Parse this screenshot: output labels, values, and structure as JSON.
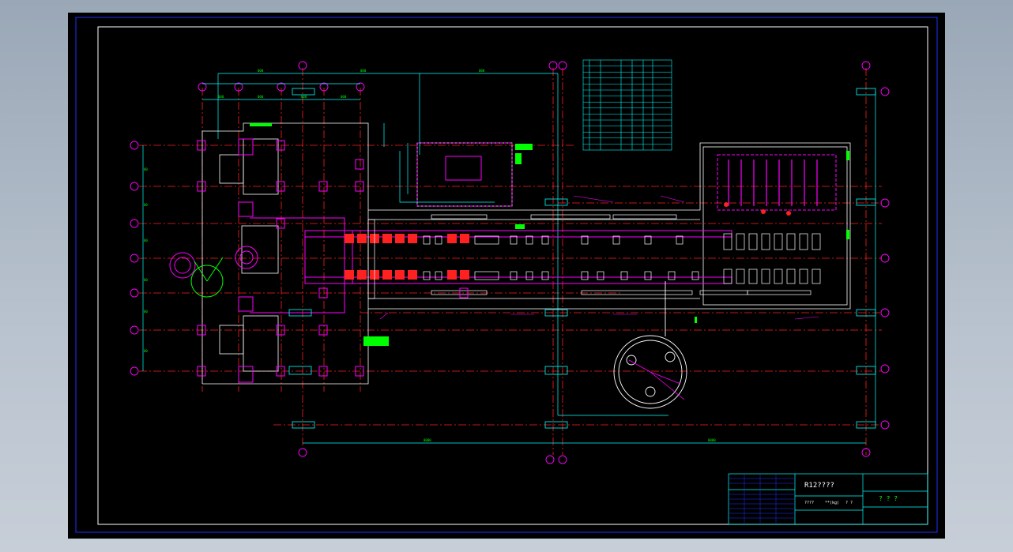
{
  "drawing": {
    "title_block_title": "R12????",
    "title_block_code": "? ? ?",
    "title_block_scale": "????",
    "title_block_ratio": "**(kg)",
    "title_block_marks": "? ?",
    "colors": {
      "background": "#000000",
      "frame": "#ffffff",
      "outer_frame": "#2030ff",
      "axis": "#ff2020",
      "dimension": "#00ffff",
      "equipment": "#ff00ff",
      "annotation": "#00ff00",
      "outline": "#ffffff"
    }
  },
  "table": {
    "rows": 15,
    "cols": 6
  }
}
